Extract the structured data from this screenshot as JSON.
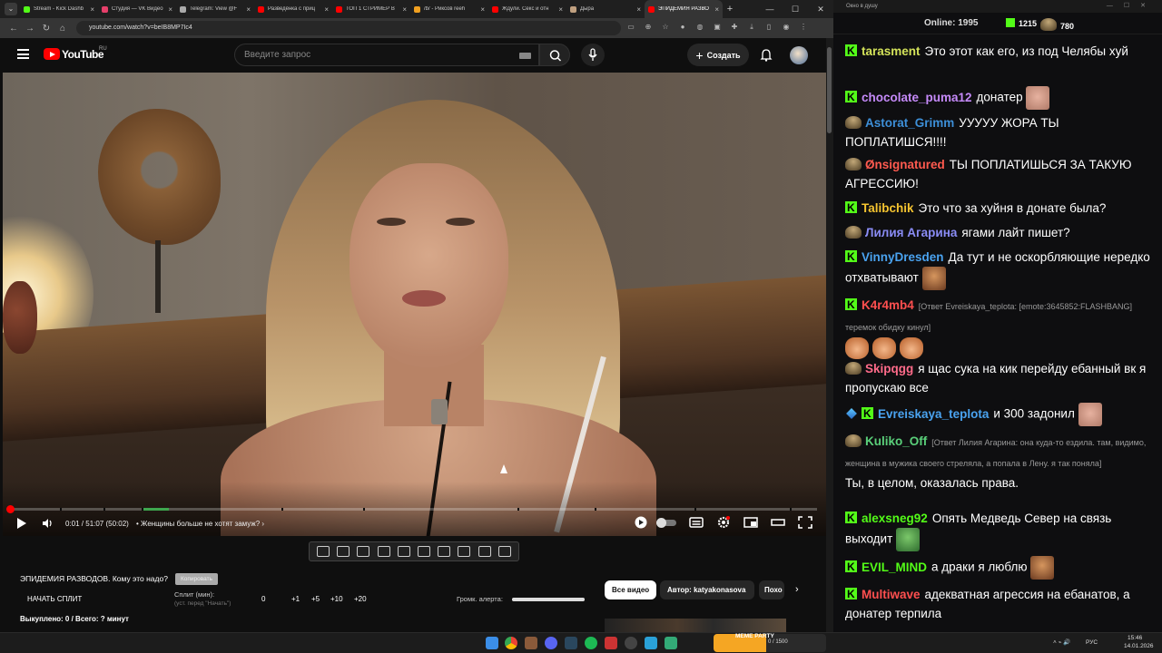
{
  "browser": {
    "tabs": [
      {
        "title": "Stream - Kick Dashb",
        "color": "#53fc18"
      },
      {
        "title": "Студия — VK Видео",
        "color": "#e63f6a"
      },
      {
        "title": "Telegram: View @F",
        "color": "#aaaaaa"
      },
      {
        "title": "Разведёнка с приц",
        "color": "#ff0000"
      },
      {
        "title": "ТОП 1 СТРИМЕР В",
        "color": "#ff0000"
      },
      {
        "title": "/b/ - Рикcов reeh",
        "color": "#f0a020"
      },
      {
        "title": "Ждули. Секс и отн",
        "color": "#ff0000"
      },
      {
        "title": "Дыра",
        "color": "#c0a080"
      },
      {
        "title": "ЭПИДЕМИЯ РАЗВО",
        "color": "#ff0000"
      }
    ],
    "url": "youtube.com/watch?v=beIB8MP7Ic4"
  },
  "youtube": {
    "region": "RU",
    "logo_text": "YouTube",
    "search_placeholder": "Введите запрос",
    "create_label": "Создать"
  },
  "player": {
    "time": "0:01 / 51:07 (50:02)",
    "chapter": "• Женщины больше не хотят замуж?",
    "progress_percent": 0.1
  },
  "split": {
    "title": "ЭПИДЕМИЯ РАЗВОДОВ. Кому это надо?",
    "copy_label": "Копировать",
    "start_label": "НАЧАТЬ СПЛИТ",
    "split_min_label": "Сплит (мин):",
    "split_hint": "(уст. перед \"Начать\")",
    "value": "0",
    "increments": [
      "+1",
      "+5",
      "+10",
      "+20"
    ],
    "alert_volume_label": "Громк. алерта:",
    "alert_volume_percent": 100,
    "bought": "Выкуплено: 0 / Всего: ? минут"
  },
  "chips": [
    "Все видео",
    "Автор: katyakonasova",
    "Похо"
  ],
  "chat": {
    "window_title": "Окно в душу",
    "online_label": "Online:",
    "online_count": "1995",
    "kick_count": "1215",
    "hat_count": "780",
    "colors": {
      "kick": "#53fc18"
    },
    "messages": [
      {
        "badges": [
          "kick"
        ],
        "user": "tarasment",
        "color": "#d4e35a",
        "text": "Это этот как его, из под Челябы хуй"
      },
      {
        "badges": [
          "kick"
        ],
        "user": "chocolate_puma12",
        "color": "#c58af9",
        "text": "донатер",
        "emotes": [
          "face"
        ]
      },
      {
        "badges": [
          "hat"
        ],
        "user": "Astorat_Grimm",
        "color": "#3d8fd8",
        "text": "УУУУУ ЖОРА ТЫ ПОПЛАТИШСЯ!!!!"
      },
      {
        "badges": [
          "hat"
        ],
        "user": "Ønsignatured",
        "color": "#ff5a4f",
        "text": "ТЫ ПОПЛАТИШЬСЯ ЗА ТАКУЮ АГРЕССИЮ!"
      },
      {
        "badges": [
          "kick"
        ],
        "user": "Talibchik",
        "color": "#f5c430",
        "text": "Это что за хуйня в донате была?"
      },
      {
        "badges": [
          "hat"
        ],
        "user": "Лилия Агарина",
        "color": "#8a8cf5",
        "text": "ягами лайт пишет?"
      },
      {
        "badges": [
          "kick"
        ],
        "user": "VinnyDresden",
        "color": "#4aa3f0",
        "text": "Да тут и не оскорбляющие нередко отхватывают",
        "emotes": [
          "man"
        ]
      },
      {
        "badges": [
          "kick"
        ],
        "user": "K4r4mb4",
        "color": "#ff4f4f",
        "reply": "[Ответ Evreiskaya_teplota: [emote:3645852:FLASHBANG] теремок обидку кинул]",
        "text": "",
        "emotes": [
          "cat",
          "cat",
          "cat"
        ]
      },
      {
        "badges": [
          "hat"
        ],
        "user": "Skipqgg",
        "color": "#ff6b8a",
        "text": "я щас сука на кик перейду ебанный вк я пропускаю все"
      },
      {
        "badges": [
          "sword",
          "kick"
        ],
        "user": "Evreiskaya_teplota",
        "color": "#4aa3f0",
        "text": "и 300 задонил",
        "emotes": [
          "face"
        ]
      },
      {
        "badges": [
          "hat"
        ],
        "user": "Kuliko_Off",
        "color": "#5ad07a",
        "reply": "[Ответ Лилия Агарина: она куда-то ездила. там, видимо, женщина в мужика своего стреляла, а попала в Лену. я так поняла]",
        "text": "Ты, в целом, оказалась права."
      },
      {
        "badges": [
          "kick"
        ],
        "user": "alexsneg92",
        "color": "#53fc18",
        "text": "Опять Медведь Север на связь выходит",
        "emotes": [
          "frog"
        ]
      },
      {
        "badges": [
          "kick"
        ],
        "user": "EVIL_MIND",
        "color": "#53fc18",
        "text": "а драки я люблю",
        "emotes": [
          "man"
        ]
      },
      {
        "badges": [
          "kick"
        ],
        "user": "Multiwave",
        "color": "#ff4f4f",
        "text": "адекватная агрессия на ебанатов, а донатер терпила"
      }
    ]
  },
  "taskbar": {
    "banner_title": "MEME PARTY",
    "banner_count": "0 / 1500",
    "lang": "РУС",
    "time": "15:46",
    "date": "14.01.2026"
  }
}
